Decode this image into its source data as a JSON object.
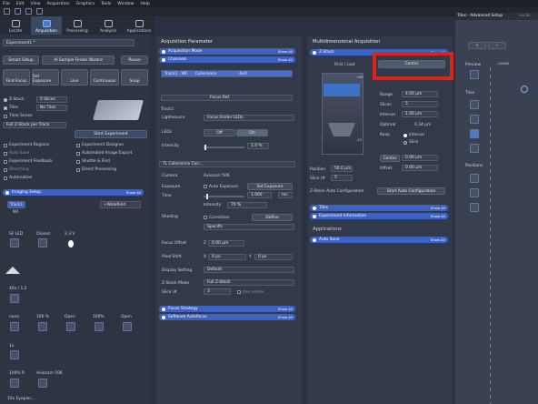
{
  "menu": [
    "File",
    "Edit",
    "View",
    "Acquisition",
    "Graphics",
    "Tools",
    "Window",
    "Help"
  ],
  "nav_tabs": [
    "Locate",
    "Acquisition",
    "Processing",
    "Analysis",
    "Applications"
  ],
  "left": {
    "experiment": "Experiment1 *",
    "smart_setup": "Smart Setup",
    "ai_finder": "AI Sample Finder Wizard",
    "reuse": "Reuse",
    "actions": [
      "Find Focus",
      "Set Exposure",
      "Live",
      "Continuous",
      "Snap"
    ],
    "options": [
      {
        "label": "Z-Stack",
        "value": "5 Slices",
        "checked": true
      },
      {
        "label": "Tiles",
        "value": "No Tiles",
        "checked": true
      },
      {
        "label": "Time Series",
        "value": "—",
        "checked": false
      }
    ],
    "zstack_mode": "Full Z-Stack per Track",
    "start_experiment": "Start Experiment",
    "tools_left": [
      "Experiment Regions",
      "Auto Save",
      "Experiment Feedback",
      "Bleaching",
      "Automation"
    ],
    "tools_right": [
      "Experiment Designer",
      "Automated Image Export",
      "Shuttle & Find",
      "Direct Processing"
    ],
    "imaging_setup": "Imaging Setup",
    "show_all": "Show All",
    "track": "Track1",
    "wf": "WF",
    "widefield": "+Widefield",
    "led": "SF LED",
    "closed": "Closed",
    "voltage": "2.3 V",
    "objective": "40x / 1.2",
    "none": "none",
    "pct1": "100 %",
    "open1": "Open",
    "pct2": "100%",
    "open2": "Open",
    "tube": "1x",
    "camera_pct": "100% R",
    "camera": "Axiocam 506",
    "eyepiece": "10x Eyepiec..."
  },
  "center": {
    "header": "Acquisition Parameter",
    "acq_mode": "Acquisition Mode",
    "channels": "Channels",
    "track1": "Track1",
    "wf": "WF",
    "coherence": "Coherence",
    "refl": "Refl",
    "focus_ref": "Focus Ref.",
    "track_label": "Track1",
    "lightsource_label": "Lightsource",
    "lightsource": "Focus Finder LEDs",
    "leds_label": "LEDs",
    "off": "Off",
    "on": "On",
    "intensity_label": "Intensity",
    "intensity": "1.0 %",
    "tl_coherence": "TL Coherence Con...",
    "camera_label": "Camera",
    "camera": "Axiocam 506",
    "exposure_label": "Exposure",
    "auto_exposure": "Auto Exposure",
    "set_exposure": "Set Exposure",
    "time_label": "Time",
    "time_value": "1.000",
    "time_unit": "ms",
    "intensity2_label": "Intensity",
    "intensity2": "70 %",
    "shading_label": "Shading",
    "correction": "Correction",
    "define": "Define",
    "specific": "Specific",
    "focus_offset_label": "Focus Offset",
    "focus_offset": "0.00 µm",
    "pixel_shift_label": "Pixel Shift",
    "pixel_x": "0 px",
    "pixel_y": "0 px",
    "display_label": "Display Setting",
    "display": "Default",
    "zmode_label": "Z-Stack Mode",
    "zmode": "Full Z-Stack",
    "slice_label": "Slice \\#",
    "slice": "3",
    "use_center": "Use center",
    "focus_strategy": "Focus Strategy",
    "software_af": "Software Autofocus"
  },
  "right": {
    "header": "Multidimensional Acquisition",
    "zstack": "Z-Stack",
    "first_last": "First / Last",
    "center": "Center",
    "range_label": "Range",
    "range": "4.00 µm",
    "slices_label": "Slices",
    "slices": "5",
    "interval_label": "Interval",
    "interval": "1.00 µm",
    "optimal_label": "Optimal",
    "optimal": "0.34 µm",
    "keep_label": "Keep",
    "keep_interval": "Interval",
    "keep_slice": "Slice",
    "center_btn": "Center",
    "center_val": "0.00 µm",
    "offset_label": "Offset",
    "offset": "0.00 µm",
    "position_label": "Position",
    "position": "50.0 µm",
    "slice_label": "Slice \\#",
    "slice": "5",
    "zac_label": "Z-Stack Auto Configuration",
    "zac_btn": "Start Auto Configuration",
    "tiles": "Tiles",
    "exp_info": "Experiment Information",
    "applications": "Applications",
    "auto_save": "Auto Save",
    "show_all": "Show All",
    "scale_top": "+60",
    "scale_bottom": "-20"
  },
  "farright": {
    "title": "Tiles - Advanced Setup",
    "tab2": "Locat...",
    "preview": "Preview",
    "tiles": "Tiles",
    "positions": "Positions",
    "ruler": "-20000"
  }
}
